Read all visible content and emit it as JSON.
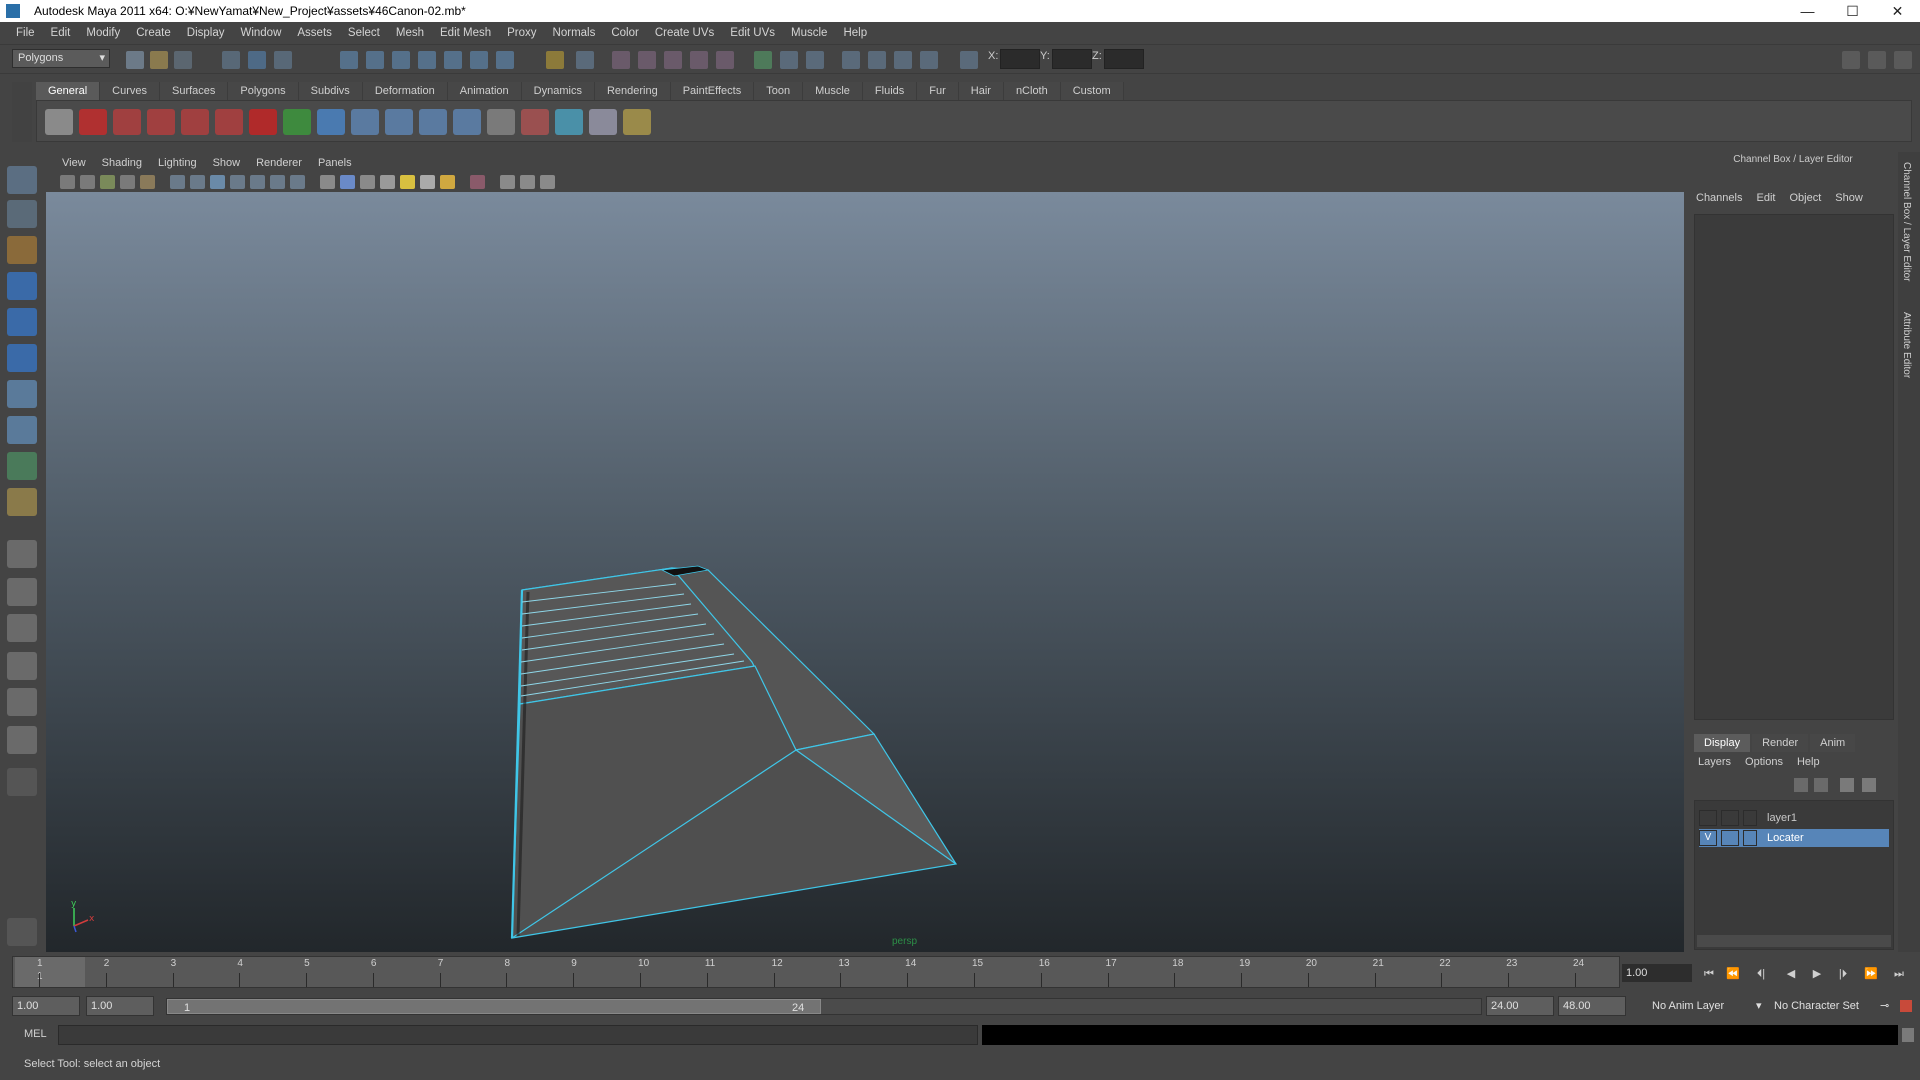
{
  "window": {
    "title": "Autodesk Maya 2011 x64: O:¥NewYamat¥New_Project¥assets¥46Canon-02.mb*",
    "minimize": "—",
    "maximize": "☐",
    "close": "✕"
  },
  "menubar": [
    "File",
    "Edit",
    "Modify",
    "Create",
    "Display",
    "Window",
    "Assets",
    "Select",
    "Mesh",
    "Edit Mesh",
    "Proxy",
    "Normals",
    "Color",
    "Create UVs",
    "Edit UVs",
    "Muscle",
    "Help"
  ],
  "statusline": {
    "mode": "Polygons",
    "x_label": "X:",
    "y_label": "Y:",
    "z_label": "Z:"
  },
  "shelf": {
    "tabs": [
      "General",
      "Curves",
      "Surfaces",
      "Polygons",
      "Subdivs",
      "Deformation",
      "Animation",
      "Dynamics",
      "Rendering",
      "PaintEffects",
      "Toon",
      "Muscle",
      "Fluids",
      "Fur",
      "Hair",
      "nCloth",
      "Custom"
    ],
    "active_tab": "General"
  },
  "viewport": {
    "menus": [
      "View",
      "Shading",
      "Lighting",
      "Show",
      "Renderer",
      "Panels"
    ],
    "camera_label": "persp",
    "axis_y": "y",
    "axis_x": "x"
  },
  "channel_box": {
    "title": "Channel Box / Layer Editor",
    "menus": [
      "Channels",
      "Edit",
      "Object",
      "Show"
    ],
    "side_tabs": [
      "Channel Box / Layer Editor",
      "Attribute Editor"
    ]
  },
  "layer_editor": {
    "tabs": [
      "Display",
      "Render",
      "Anim"
    ],
    "active_tab": "Display",
    "menus": [
      "Layers",
      "Options",
      "Help"
    ],
    "layers": [
      {
        "name": "layer1",
        "visible": "",
        "selected": false
      },
      {
        "name": "Locater",
        "visible": "V",
        "selected": true
      }
    ]
  },
  "timeline": {
    "ticks": [
      "1",
      "2",
      "3",
      "4",
      "5",
      "6",
      "7",
      "8",
      "9",
      "10",
      "11",
      "12",
      "13",
      "14",
      "15",
      "16",
      "17",
      "18",
      "19",
      "20",
      "21",
      "22",
      "23",
      "24"
    ],
    "current_frame": "1",
    "current_time_field": "1.00",
    "playback_buttons": [
      "⏮",
      "⏪",
      "⏴|",
      "◀",
      "▶",
      "|⏵",
      "⏩",
      "⏭"
    ]
  },
  "range": {
    "start_time": "1.00",
    "playback_start": "1.00",
    "range_start": "1",
    "range_end": "24",
    "playback_end": "24.00",
    "end_time": "48.00",
    "anim_layer": "No Anim Layer",
    "character_set": "No Character Set"
  },
  "command_line": {
    "label": "MEL"
  },
  "help_line": {
    "text": "Select Tool: select an object"
  }
}
